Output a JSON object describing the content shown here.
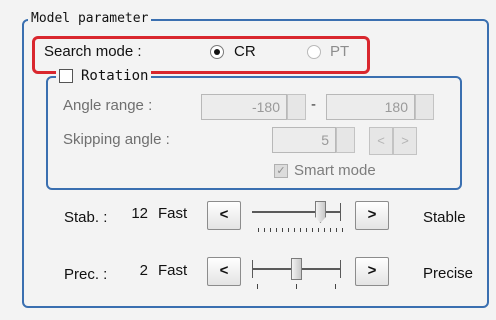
{
  "model_parameter": {
    "legend": "Model parameter",
    "search_mode": {
      "label": "Search mode :",
      "options": [
        {
          "label": "CR",
          "selected": true,
          "enabled": true
        },
        {
          "label": "PT",
          "selected": false,
          "enabled": false
        }
      ]
    },
    "rotation": {
      "legend": "Rotation",
      "checked": false,
      "angle_range": {
        "label": "Angle range :",
        "min": "-180",
        "separator": "-",
        "max": "180"
      },
      "skipping_angle": {
        "label": "Skipping angle :",
        "value": "5",
        "prev_label": "<",
        "next_label": ">"
      },
      "smart_mode": {
        "label": "Smart mode",
        "checked": true,
        "enabled": false
      }
    },
    "stab": {
      "label": "Stab. :",
      "value": "12",
      "low_label": "Fast",
      "high_label": "Stable",
      "dec_label": "<",
      "inc_label": ">",
      "level_fraction": 0.85
    },
    "prec": {
      "label": "Prec. :",
      "value": "2",
      "low_label": "Fast",
      "high_label": "Precise",
      "dec_label": "<",
      "inc_label": ">",
      "level_fraction": 0.5
    }
  },
  "colors": {
    "frame": "#3a6fb0",
    "highlight": "#d9272e",
    "background": "#f3f3f3"
  },
  "icons": [
    "radio-selected",
    "radio-unselected",
    "checkbox-empty",
    "checkbox-checked"
  ]
}
